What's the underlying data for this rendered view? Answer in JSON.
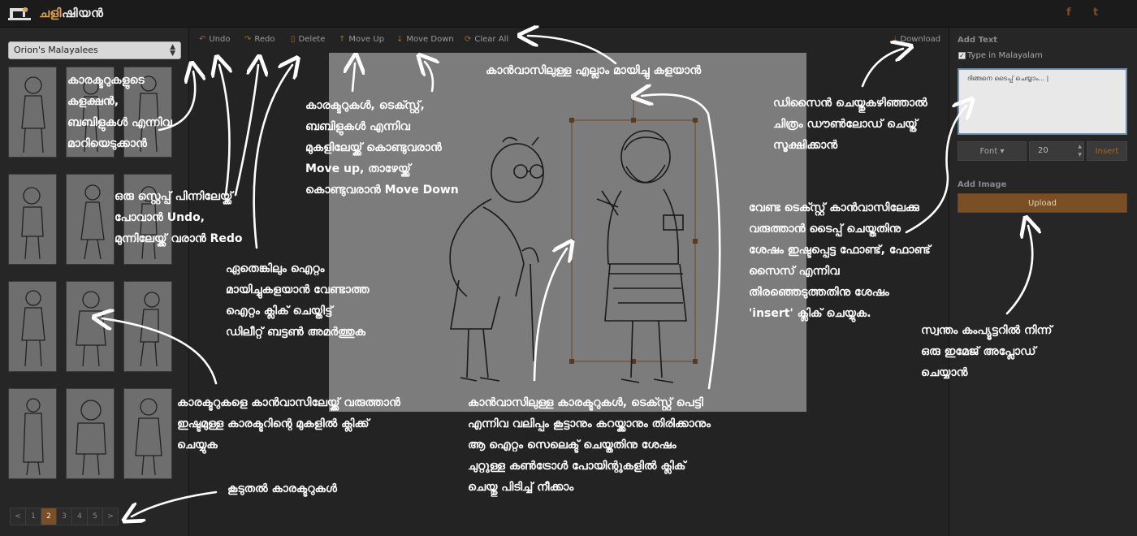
{
  "header": {
    "logo_main": "ചളി",
    "logo_rest": "ഷിയൻ",
    "social_facebook": "f",
    "social_twitter": "t"
  },
  "collection": {
    "selected": "Orion's Malayalees",
    "pagination": [
      "<",
      "1",
      "2",
      "3",
      "4",
      "5",
      ">"
    ],
    "active_page": "2"
  },
  "toolbar": {
    "undo": "Undo",
    "redo": "Redo",
    "delete": "Delete",
    "move_up": "Move Up",
    "move_down": "Move Down",
    "clear_all": "Clear All",
    "download": "Download"
  },
  "right_panel": {
    "add_text_label": "Add Text",
    "type_malayalam_label": "Type in Malayalam",
    "type_malayalam_checked": true,
    "textarea_value": "ദിങ്ങനെ ടൈപ്പ് ചെയ്യാം... |",
    "font_button": "Font ▾",
    "font_size": "20",
    "insert_button": "Insert",
    "add_image_label": "Add Image",
    "upload_button": "Upload"
  },
  "annotations": {
    "characters_switch": "കാരക്ടറുകളുടെ\nകളക്ഷൻ,\nബബിളുകൾ എന്നിവ\nമാറിയെടുക്കാൻ",
    "undo_redo": "ഒരു സ്റ്റെപ്പ് പിന്നിലേയ്ക്ക്\nപോവാൻ Undo,\nമുന്നിലേയ്ക്ക് വരാൻ Redo",
    "delete": "ഏതെങ്കിലും ഐറ്റം\nമായിച്ചുകളയാൻ വേണ്ടാത്ത\nഐറ്റം ക്ലിക് ചെയ്തിട്ട്\nഡിലീറ്റ് ബട്ടൺ അമർത്തുക",
    "move": "കാരക്ടറുകൾ, ടെക്സ്റ്റ്,\nബബിളുകൾ എന്നിവ\nമുകളിലേയ്ക്ക് കൊണ്ടുവരാൻ\nMove up, താഴേയ്ക്ക്\nകൊണ്ടുവരാൻ Move Down",
    "clear_all": "കാൻവാസിലുള്ള എല്ലാം മായിച്ചു കളയാൻ",
    "download": "ഡിസൈൻ ചെയ്തുകഴിഞ്ഞാൽ\nചിത്രം ഡൗൺലോഡ് ചെയ്ത്\nസൂക്ഷിക്കാൻ",
    "add_character": "കാരക്ടറുകളെ കാൻവാസിലേയ്ക്ക് വരുത്താൻ\nഇഷ്ടമുള്ള കാരക്ടറിന്റെ മുകളിൽ ക്ലിക്ക്\nചെയ്യുക",
    "more_characters": "കൂടുതൽ കാരക്ടറുകൾ",
    "resize": "കാൻവാസിലുള്ള കാരക്ടറുകൾ, ടെക്സ്റ്റ് പെട്ടി\nഎന്നിവ വലിപ്പം കൂട്ടാനും കറയ്ക്കാനും തിരിക്കാനും\nആ ഐറ്റം സെലെക്ട് ചെയ്തതിനു ശേഷം\nചുറ്റുള്ള കൺട്രോൾ പോയിന്റുകളിൽ ക്ലിക്\nചെയ്തു പിടിച്ച് നീക്കാം",
    "insert_text": "വേണ്ട ടെക്സ്റ്റ് കാൻവാസിലേക്കു\nവരുത്താൻ ടൈപ്പ് ചെയ്തതിനു\nശേഷം ഇഷ്ടപ്പെട്ട ഫോണ്ട്, ഫോണ്ട്\nസൈസ് എന്നിവ\nതിരഞ്ഞെടുത്തതിനു ശേഷം\n'insert' ക്ലിക് ചെയ്യുക.",
    "upload_image": "സ്വന്തം കംപ്യൂട്ടറിൽ നിന്ന്\nഒരു ഇമേജ് അപ്ലോഡ്\nചെയ്യാൻ"
  },
  "colors": {
    "accent": "#7a4f26",
    "background": "#232323",
    "canvas": "#7c7c7c",
    "annotation": "#ffffff"
  }
}
